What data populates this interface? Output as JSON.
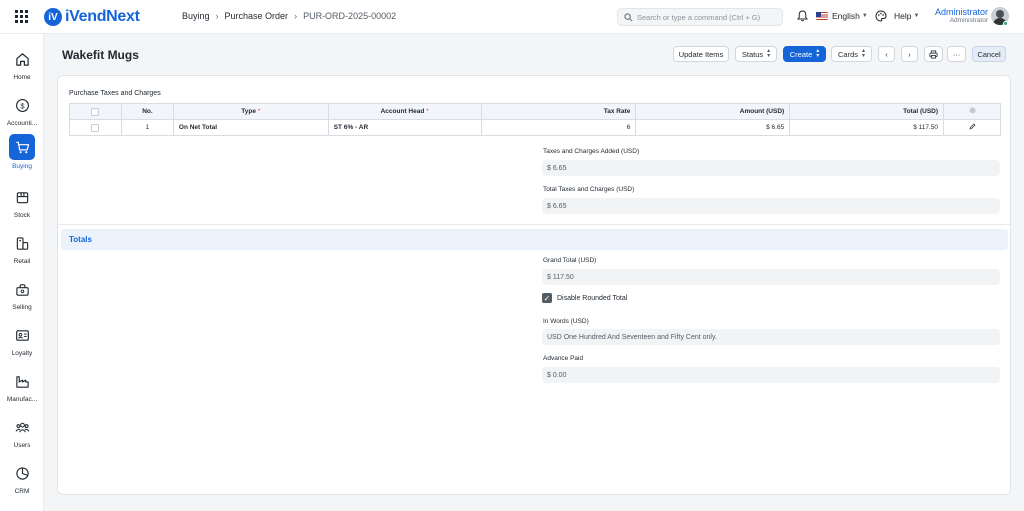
{
  "app": {
    "logo_mark": "iV",
    "logo_text": "iVendNext"
  },
  "breadcrumb": [
    "Buying",
    "Purchase Order",
    "PUR-ORD-2025-00002"
  ],
  "search": {
    "placeholder": "Search or type a command (Ctrl + G)"
  },
  "header": {
    "language": "English",
    "help": "Help",
    "user_name": "Administrator",
    "user_role": "Administrator"
  },
  "sidebar": [
    {
      "label": "Home",
      "icon": "home-icon"
    },
    {
      "label": "Accounti...",
      "icon": "dollar-icon"
    },
    {
      "label": "Buying",
      "icon": "cart-icon",
      "active": true
    },
    {
      "label": "Stock",
      "icon": "box-icon"
    },
    {
      "label": "Retail",
      "icon": "retail-icon"
    },
    {
      "label": "Selling",
      "icon": "selling-icon"
    },
    {
      "label": "Loyalty",
      "icon": "loyalty-icon"
    },
    {
      "label": "Manufac...",
      "icon": "factory-icon"
    },
    {
      "label": "Users",
      "icon": "users-icon"
    },
    {
      "label": "CRM",
      "icon": "crm-icon"
    }
  ],
  "page": {
    "title": "Wakefit Mugs",
    "buttons": {
      "update_items": "Update Items",
      "status": "Status",
      "create": "Create",
      "cards": "Cards",
      "more": "···",
      "cancel": "Cancel"
    }
  },
  "taxes": {
    "section_label": "Purchase Taxes and Charges",
    "columns": [
      "No.",
      "Type",
      "Account Head",
      "Tax Rate",
      "Amount (USD)",
      "Total (USD)"
    ],
    "rows": [
      {
        "no": "1",
        "type": "On Net Total",
        "account_head": "ST 6% - AR",
        "tax_rate": "6",
        "amount": "$ 6.65",
        "total": "$ 117.50"
      }
    ]
  },
  "fields": {
    "taxes_added_label": "Taxes and Charges Added (USD)",
    "taxes_added_value": "$ 6.65",
    "total_taxes_label": "Total Taxes and Charges (USD)",
    "total_taxes_value": "$ 6.65"
  },
  "totals": {
    "section_title": "Totals",
    "grand_total_label": "Grand Total (USD)",
    "grand_total_value": "$ 117.50",
    "disable_rounded_label": "Disable Rounded Total",
    "disable_rounded_checked": true,
    "in_words_label": "In Words (USD)",
    "in_words_value": "USD One Hundred And Seventeen and Fifty Cent only.",
    "advance_paid_label": "Advance Paid",
    "advance_paid_value": "$ 0.00"
  },
  "colors": {
    "primary": "#1565d8",
    "status_online": "#30a66d"
  }
}
